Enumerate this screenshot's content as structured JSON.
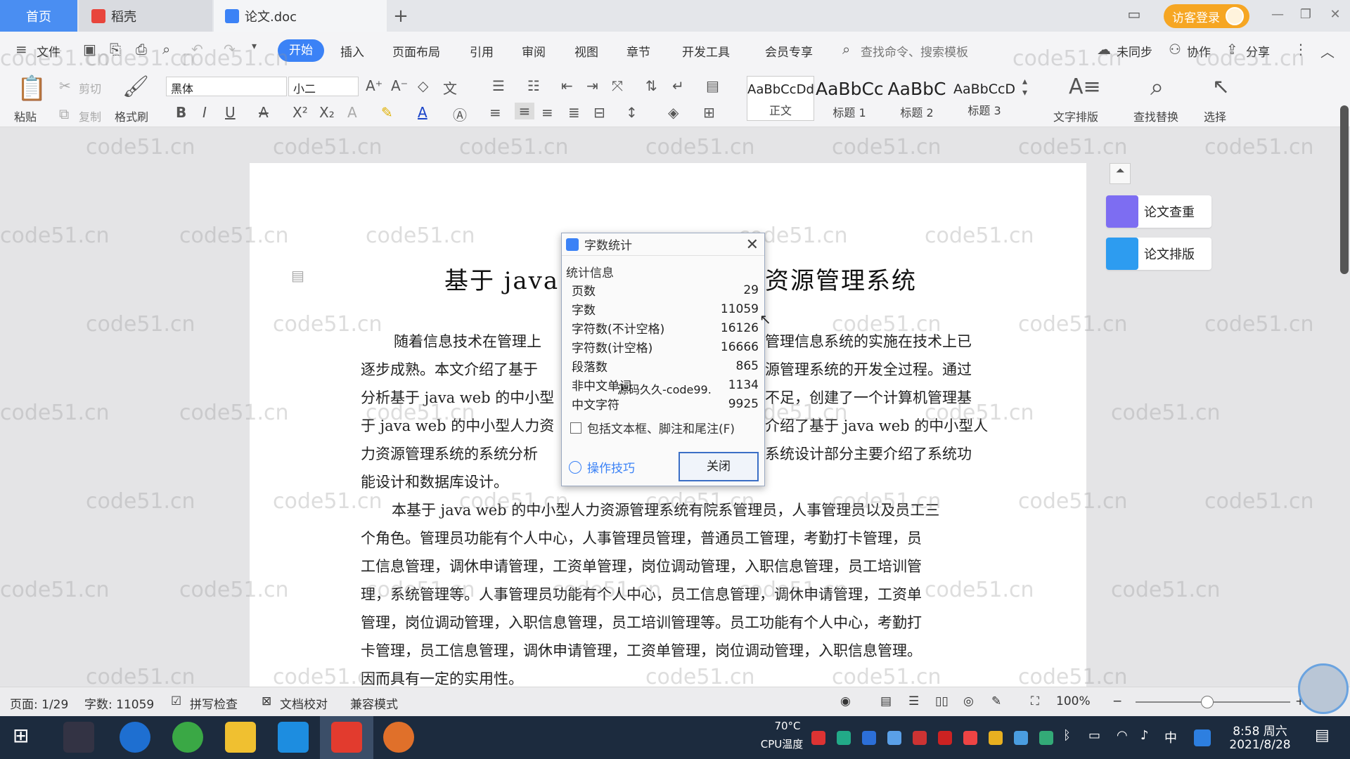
{
  "tabs": {
    "home": "首页",
    "daoke": "稻壳",
    "doc": "论文.doc",
    "add": "+"
  },
  "header": {
    "login": "访客登录"
  },
  "menu": {
    "file": "文件",
    "items": [
      "开始",
      "插入",
      "页面布局",
      "引用",
      "审阅",
      "视图",
      "章节",
      "开发工具",
      "会员专享"
    ],
    "search_placeholder": "查找命令、搜索模板",
    "sync": "未同步",
    "collab": "协作",
    "share": "分享"
  },
  "ribbon": {
    "paste": "粘贴",
    "cut": "剪切",
    "copy": "复制",
    "format_painter": "格式刷",
    "font_name": "黑体",
    "font_size": "小二",
    "styles": [
      {
        "preview": "AaBbCcDd",
        "name": "正文"
      },
      {
        "preview": "AaBbCc",
        "name": "标题 1"
      },
      {
        "preview": "AaBbC",
        "name": "标题 2"
      },
      {
        "preview": "AaBbCcD",
        "name": "标题 3"
      }
    ],
    "text_layout": "文字排版",
    "find_replace": "查找替换",
    "select": "选择"
  },
  "watermark": "code51.cn",
  "document": {
    "title_left": "基于 java",
    "title_right": "资源管理系统",
    "para1": [
      "随着信息技术在管理上",
      "管理信息系统的实施在技术上已",
      "逐步成熟。本文介绍了基于",
      "源管理系统的开发全过程。通过",
      "分析基于 java web 的中小型",
      "不足，创建了一个计算机管理基",
      "于 java web 的中小型人力资",
      "介绍了基于 java web 的中小型人",
      "力资源管理系统的系统分析",
      "系统设计部分主要介绍了系统功",
      "能设计和数据库设计。"
    ],
    "para2": [
      "本基于 java web 的中小型人力资源管理系统有院系管理员，人事管理员以及员工三",
      "个角色。管理员功能有个人中心，人事管理员管理，普通员工管理，考勤打卡管理，员",
      "工信息管理，调休申请管理，工资单管理，岗位调动管理，入职信息管理，员工培训管",
      "理，系统管理等。人事管理员功能有个人中心，员工信息管理，调休申请管理，工资单",
      "管理，岗位调动管理，入职信息管理，员工培训管理等。员工功能有个人中心，考勤打",
      "卡管理，员工信息管理，调休申请管理，工资单管理，岗位调动管理，入职信息管理。",
      "因而具有一定的实用性。"
    ]
  },
  "right_panel": {
    "check": "论文查重",
    "layout": "论文排版"
  },
  "dialog": {
    "title": "字数统计",
    "group": "统计信息",
    "rows": [
      {
        "label": "页数",
        "value": "29"
      },
      {
        "label": "字数",
        "value": "11059"
      },
      {
        "label": "字符数(不计空格)",
        "value": "16126"
      },
      {
        "label": "字符数(计空格)",
        "value": "16666"
      },
      {
        "label": "段落数",
        "value": "865"
      },
      {
        "label": "非中文单词",
        "value": "1134"
      },
      {
        "label": "中文字符",
        "value": "9925"
      }
    ],
    "overlay_text": "源码久久-code99.",
    "checkbox": "包括文本框、脚注和尾注(F)",
    "tips": "操作技巧",
    "close": "关闭"
  },
  "status": {
    "page": "页面: 1/29",
    "words": "字数: 11059",
    "spell": "拼写检查",
    "proof": "文档校对",
    "compat": "兼容模式",
    "zoom": "100%"
  },
  "taskbar": {
    "temp": "70°C",
    "cpu": "CPU温度",
    "ime": "中",
    "time": "8:58 周六",
    "date": "2021/8/28"
  },
  "colors": {
    "accent": "#3b82f6",
    "login": "#f6a623",
    "taskbar": "#1c2b3e"
  }
}
